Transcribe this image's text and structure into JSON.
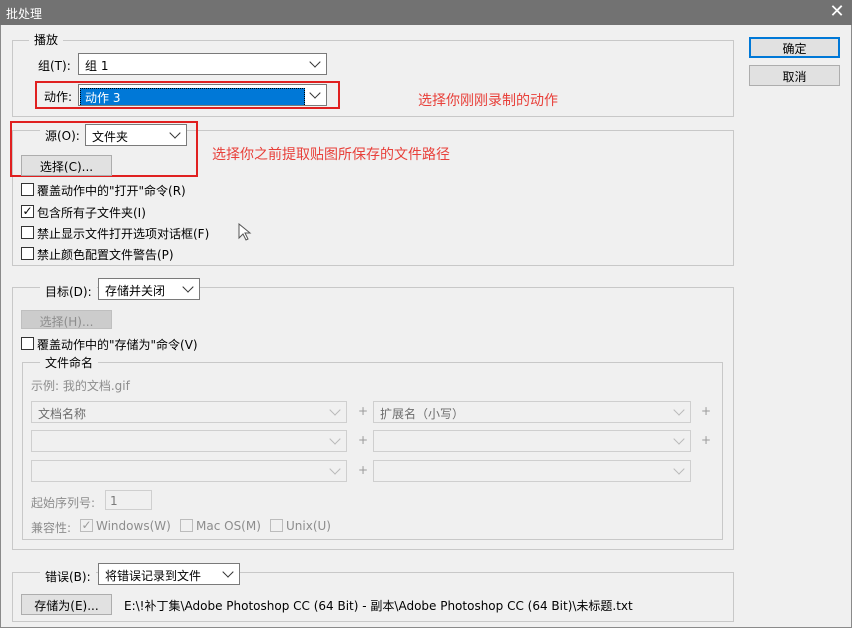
{
  "window": {
    "title": "批处理",
    "close_glyph": "✕"
  },
  "buttons": {
    "ok": "确定",
    "cancel": "取消"
  },
  "play": {
    "legend": "播放",
    "group_label": "组(T):",
    "group_value": "组 1",
    "action_label": "动作:",
    "action_value": "动作 3"
  },
  "source": {
    "label": "源(O):",
    "value": "文件夹",
    "choose": "选择(C)...",
    "options": [
      {
        "label": "覆盖动作中的\"打开\"命令(R)",
        "checked": false
      },
      {
        "label": "包含所有子文件夹(I)",
        "checked": true
      },
      {
        "label": "禁止显示文件打开选项对话框(F)",
        "checked": false
      },
      {
        "label": "禁止颜色配置文件警告(P)",
        "checked": false
      }
    ]
  },
  "destination": {
    "label": "目标(D):",
    "value": "存储并关闭",
    "choose": "选择(H)...",
    "override": "覆盖动作中的\"存储为\"命令(V)",
    "naming": {
      "legend": "文件命名",
      "example": "示例: 我的文档.gif",
      "rows": [
        {
          "left": "文档名称",
          "right": "扩展名（小写）"
        },
        {
          "left": "",
          "right": ""
        },
        {
          "left": "",
          "right": ""
        }
      ],
      "plus": "+",
      "serial_label": "起始序列号:",
      "serial_value": "1",
      "compat_label": "兼容性:",
      "compat": [
        {
          "label": "Windows(W)",
          "checked": true
        },
        {
          "label": "Mac OS(M)",
          "checked": false
        },
        {
          "label": "Unix(U)",
          "checked": false
        }
      ]
    }
  },
  "errors": {
    "label": "错误(B):",
    "value": "将错误记录到文件",
    "save_as": "存储为(E)...",
    "path": "E:\\!补丁集\\Adobe Photoshop CC (64 Bit) - 副本\\Adobe Photoshop CC (64 Bit)\\未标题.txt"
  },
  "annotations": {
    "action_note": "选择你刚刚录制的动作",
    "source_note": "选择你之前提取贴图所保存的文件路径",
    "color": "#e8403a"
  }
}
